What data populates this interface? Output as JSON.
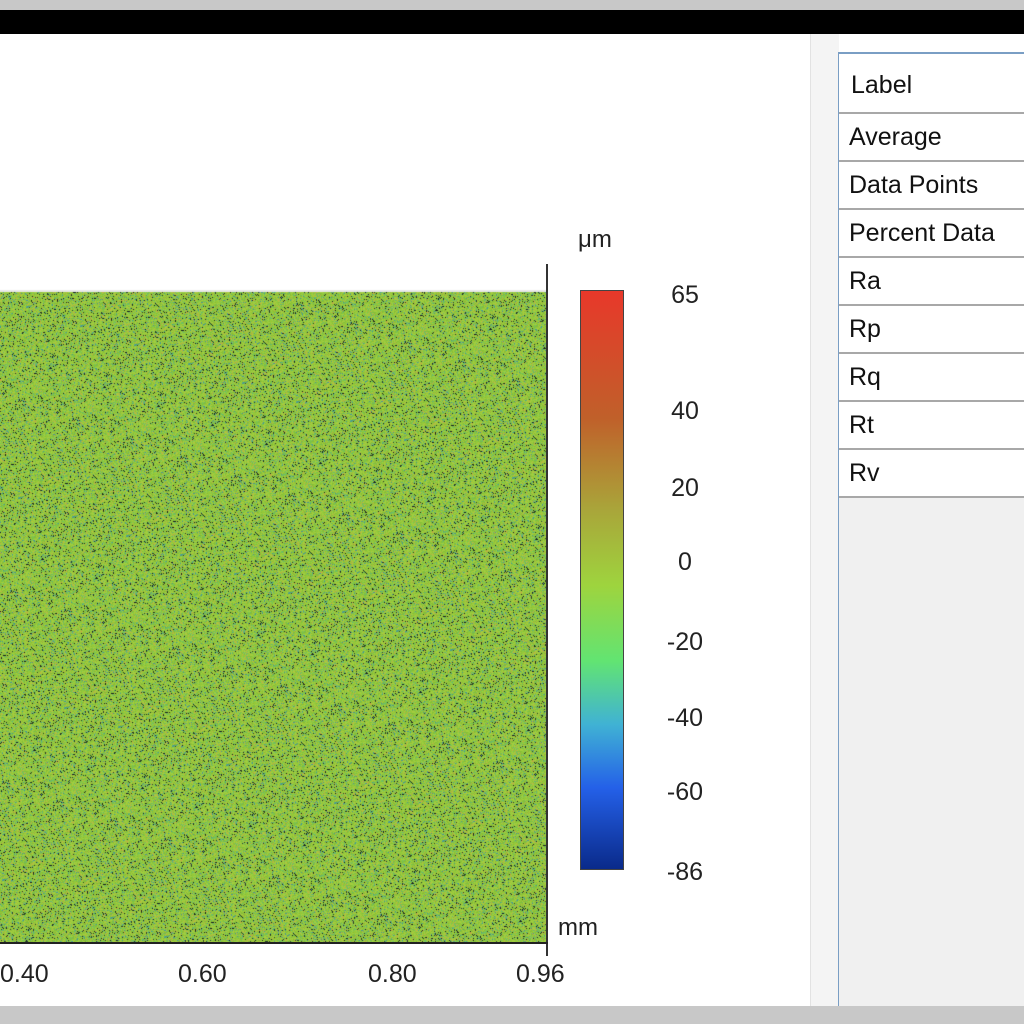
{
  "colorbar": {
    "unit": "μm",
    "ticks": [
      "65",
      "40",
      "20",
      "0",
      "-20",
      "-40",
      "-60",
      "-86"
    ],
    "stops": [
      "#e8382a",
      "#c0602a",
      "#a9a63a",
      "#9ed43e",
      "#62e472",
      "#40b2d4",
      "#2460e8",
      "#0a2a8a"
    ]
  },
  "x_axis": {
    "unit": "mm",
    "ticks": [
      "0.40",
      "0.60",
      "0.80",
      "0.96"
    ]
  },
  "table": {
    "header": "Label",
    "rows": [
      "Average",
      "Data Points",
      "Percent Data",
      "Ra",
      "Rp",
      "Rq",
      "Rt",
      "Rv"
    ]
  },
  "colors": {
    "surface_base": "#94c83a",
    "frame": "#000000",
    "table_border": "#7a9ec4"
  }
}
